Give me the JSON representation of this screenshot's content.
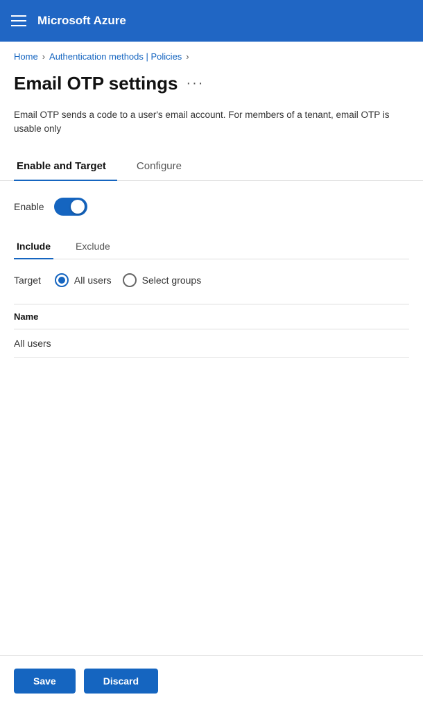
{
  "topbar": {
    "title": "Microsoft Azure",
    "hamburger_icon": "menu-icon"
  },
  "breadcrumb": {
    "items": [
      {
        "label": "Home",
        "separator": true
      },
      {
        "label": "Authentication methods | Policies",
        "separator": true
      }
    ]
  },
  "page": {
    "title": "Email OTP settings",
    "more_options_label": "···",
    "description": "Email OTP sends a code to a user's email account. For members of a tenant, email OTP is usable only"
  },
  "tabs": [
    {
      "label": "Enable and Target",
      "active": true
    },
    {
      "label": "Configure",
      "active": false
    }
  ],
  "enable_section": {
    "label": "Enable",
    "enabled": true
  },
  "sub_tabs": [
    {
      "label": "Include",
      "active": true
    },
    {
      "label": "Exclude",
      "active": false
    }
  ],
  "target_section": {
    "label": "Target",
    "options": [
      {
        "label": "All users",
        "selected": true
      },
      {
        "label": "Select groups",
        "selected": false
      }
    ]
  },
  "table": {
    "column_name": "Name",
    "rows": [
      {
        "name": "All users"
      }
    ]
  },
  "footer": {
    "save_label": "Save",
    "discard_label": "Discard"
  }
}
